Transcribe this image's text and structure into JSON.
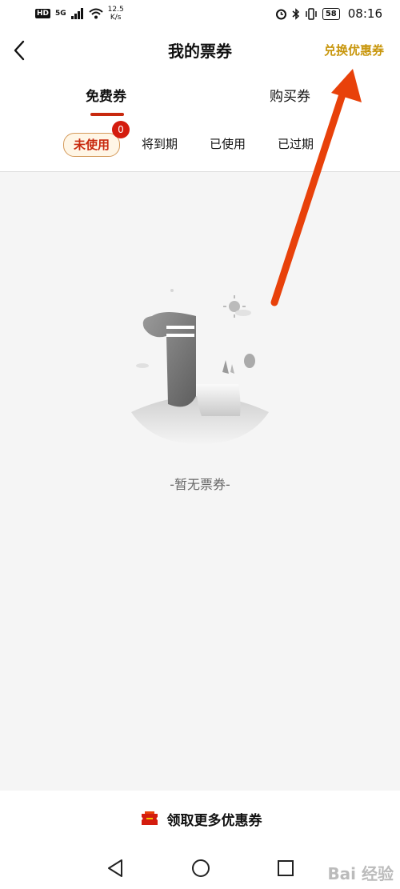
{
  "status_bar": {
    "hd_label": "HD",
    "net_type": "5G",
    "net_speed_value": "12.5",
    "net_speed_unit": "K/s",
    "battery": "58",
    "time": "08:16"
  },
  "header": {
    "title": "我的票券",
    "redeem_label": "兑换优惠券"
  },
  "main_tabs": [
    {
      "label": "免费券",
      "active": true
    },
    {
      "label": "购买券",
      "active": false
    }
  ],
  "sub_tabs": [
    {
      "label": "未使用",
      "active": true,
      "badge": "0"
    },
    {
      "label": "将到期",
      "active": false
    },
    {
      "label": "已使用",
      "active": false
    },
    {
      "label": "已过期",
      "active": false
    }
  ],
  "empty_state": {
    "text": "-暂无票券-"
  },
  "bottom": {
    "more_coupons_label": "领取更多优惠券"
  },
  "watermark": "Bai 经验",
  "colors": {
    "accent_red": "#c8290e",
    "redeem_gold": "#c8960c",
    "badge_red": "#d41c0e",
    "arrow_red": "#e8410a"
  },
  "icons": {
    "back": "chevron-left-icon",
    "coupon": "red-ticket-icon",
    "nav_back": "triangle-back-icon",
    "nav_home": "circle-home-icon",
    "nav_recent": "square-recent-icon"
  }
}
